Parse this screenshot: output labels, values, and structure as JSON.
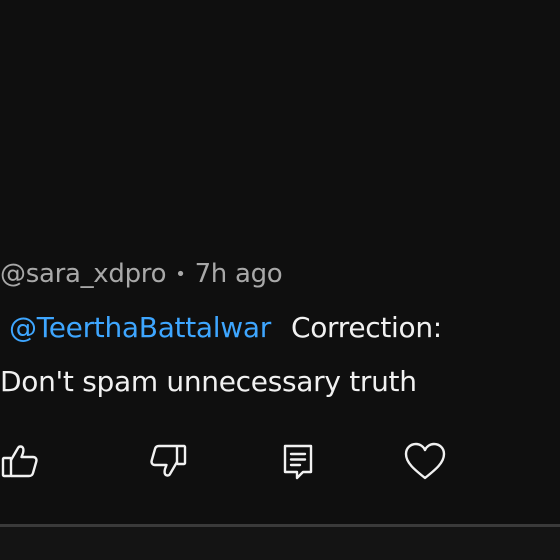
{
  "comment": {
    "author": "@sara_xdpro",
    "separator": "•",
    "time": "7h ago",
    "mention": "@TeerthaBattalwar",
    "text_line1": "Correction:",
    "text_line2": "Don't spam unnecessary truth"
  },
  "actions": [
    {
      "name": "like",
      "icon": "thumbs-up-icon"
    },
    {
      "name": "dislike",
      "icon": "thumbs-down-icon"
    },
    {
      "name": "reply",
      "icon": "comment-icon"
    },
    {
      "name": "heart",
      "icon": "heart-icon"
    }
  ],
  "colors": {
    "background": "#0f0f0f",
    "text": "#f1f1f1",
    "muted": "#a8a8a8",
    "mention": "#3ea6ff"
  }
}
